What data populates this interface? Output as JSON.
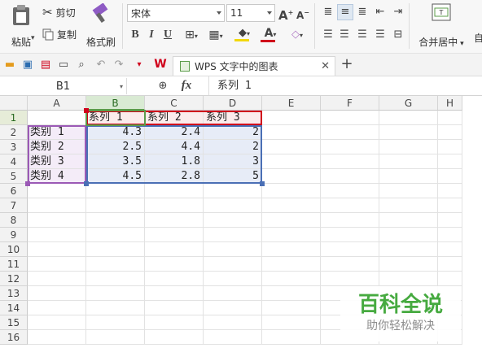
{
  "ribbon": {
    "paste_label": "粘贴",
    "cut_label": "剪切",
    "copy_label": "复制",
    "format_painter_label": "格式刷",
    "font_name": "宋体",
    "font_size": "11",
    "merge_center_label": "合并居中",
    "autowrap_label": "自"
  },
  "tab": {
    "title": "WPS 文字中的图表"
  },
  "formula_bar": {
    "cell_ref": "B1",
    "fx_label": "fx",
    "value": "系列 1"
  },
  "columns": [
    "A",
    "B",
    "C",
    "D",
    "E",
    "F",
    "G",
    "H"
  ],
  "rows": [
    "1",
    "2",
    "3",
    "4",
    "5",
    "6",
    "7",
    "8",
    "9",
    "10",
    "11",
    "12",
    "13",
    "14",
    "15",
    "16"
  ],
  "sheet": {
    "headers": [
      "",
      "系列 1",
      "系列 2",
      "系列 3"
    ],
    "data": [
      [
        "类别 1",
        "4.3",
        "2.4",
        "2"
      ],
      [
        "类别 2",
        "2.5",
        "4.4",
        "2"
      ],
      [
        "类别 3",
        "3.5",
        "1.8",
        "3"
      ],
      [
        "类别 4",
        "4.5",
        "2.8",
        "5"
      ]
    ]
  },
  "watermark": {
    "title": "百科全说",
    "subtitle": "助你轻松解决"
  },
  "colors": {
    "accent_red": "#d0021b",
    "selection_green": "#5b9c4a",
    "range_blue": "#4a6fb5",
    "range_purple": "#9b59b6"
  }
}
